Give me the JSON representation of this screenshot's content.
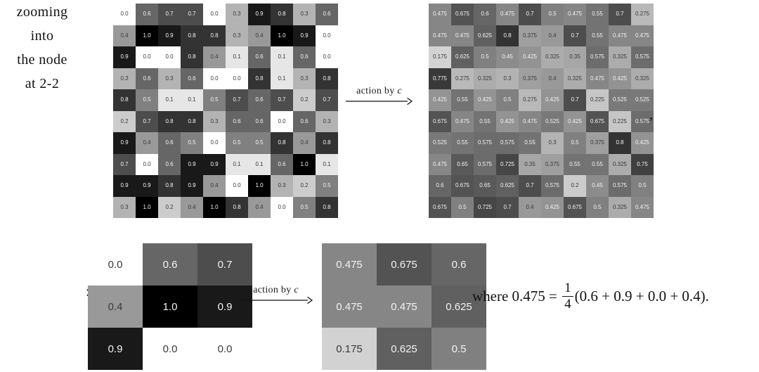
{
  "figure": {
    "arrow_top": {
      "label_plain": "action by ",
      "label_italic": "c"
    },
    "arrow_bottom": {
      "label_plain": "action by ",
      "label_italic": "c"
    },
    "comma": ",",
    "zoom_caption": "zooming\ninto\nthe node\nat 2-2",
    "zoom_caption_lines": [
      "zooming",
      "into",
      "the node",
      "at 2-2"
    ],
    "zoom_caption_colon": ":",
    "formula": {
      "prefix": "where 0.475 = ",
      "numerator": "1",
      "denominator": "4",
      "body": "(0.6 + 0.9 + 0.0 + 0.4)."
    }
  },
  "chart_data": {
    "type": "heatmap",
    "title": "",
    "grids": [
      {
        "name": "grid-before",
        "label": "input 10x10 grayscale grid",
        "rows": 10,
        "cols": 10,
        "vmin": 0.0,
        "vmax": 1.0,
        "colormap": "gray_inverted",
        "values": [
          [
            0.0,
            0.6,
            0.7,
            0.7,
            0.0,
            0.3,
            0.9,
            0.8,
            0.3,
            0.6
          ],
          [
            0.4,
            1.0,
            0.9,
            0.8,
            0.8,
            0.3,
            0.4,
            1.0,
            0.9,
            0.0
          ],
          [
            0.9,
            0.0,
            0.0,
            0.8,
            0.4,
            0.1,
            0.6,
            0.1,
            0.6,
            0.0
          ],
          [
            0.3,
            0.6,
            0.3,
            0.6,
            0.0,
            0.0,
            0.8,
            0.1,
            0.3,
            0.8
          ],
          [
            0.8,
            0.5,
            0.1,
            0.1,
            0.5,
            0.7,
            0.6,
            0.7,
            0.2,
            0.7
          ],
          [
            0.2,
            0.7,
            0.8,
            0.8,
            0.3,
            0.6,
            0.6,
            0.0,
            0.6,
            0.3
          ],
          [
            0.9,
            0.4,
            0.6,
            0.5,
            0.0,
            0.5,
            0.5,
            0.8,
            0.4,
            0.8
          ],
          [
            0.7,
            0.0,
            0.6,
            0.9,
            0.9,
            0.1,
            0.1,
            0.6,
            1.0,
            0.1
          ],
          [
            0.9,
            0.9,
            0.8,
            0.9,
            0.4,
            0.0,
            1.0,
            0.3,
            0.2,
            0.5
          ],
          [
            0.3,
            1.0,
            0.2,
            0.4,
            1.0,
            0.8,
            0.4,
            0.0,
            0.5,
            0.8
          ]
        ],
        "labels": [
          [
            "0.0",
            "0.6",
            "0.7",
            "0.7",
            "0.0",
            "0.3",
            "0.9",
            "0.8",
            "0.3",
            "0.6"
          ],
          [
            "0.4",
            "1.0",
            "0.9",
            "0.8",
            "0.8",
            "0.3",
            "0.4",
            "1.0",
            "0.9",
            "0.0"
          ],
          [
            "0.9",
            "0.0",
            "0.0",
            "0.8",
            "0.4",
            "0.1",
            "0.6",
            "0.1",
            "0.6",
            "0.0"
          ],
          [
            "0.3",
            "0.6",
            "0.3",
            "0.6",
            "0.0",
            "0.0",
            "0.8",
            "0.1",
            "0.3",
            "0.8"
          ],
          [
            "0.8",
            "0.5",
            "0.1",
            "0.1",
            "0.5",
            "0.7",
            "0.6",
            "0.7",
            "0.2",
            "0.7"
          ],
          [
            "0.2",
            "0.7",
            "0.8",
            "0.8",
            "0.3",
            "0.6",
            "0.6",
            "0.0",
            "0.6",
            "0.3"
          ],
          [
            "0.9",
            "0.4",
            "0.6",
            "0.5",
            "0.0",
            "0.5",
            "0.5",
            "0.8",
            "0.4",
            "0.8"
          ],
          [
            "0.7",
            "0.0",
            "0.6",
            "0.9",
            "0.9",
            "0.1",
            "0.1",
            "0.6",
            "1.0",
            "0.1"
          ],
          [
            "0.9",
            "0.9",
            "0.8",
            "0.9",
            "0.4",
            "0.0",
            "1.0",
            "0.3",
            "0.2",
            "0.5"
          ],
          [
            "0.3",
            "1.0",
            "0.2",
            "0.4",
            "1.0",
            "0.8",
            "0.4",
            "0.0",
            "0.5",
            "0.8"
          ]
        ]
      },
      {
        "name": "grid-after",
        "label": "output 10x10 grayscale grid after action by c",
        "rows": 10,
        "cols": 10,
        "vmin": 0.0,
        "vmax": 1.0,
        "colormap": "gray_inverted",
        "values": [
          [
            0.475,
            0.675,
            0.6,
            0.475,
            0.7,
            0.5,
            0.475,
            0.55,
            0.7,
            0.275
          ],
          [
            0.475,
            0.475,
            0.625,
            0.8,
            0.375,
            0.4,
            0.7,
            0.55,
            0.475,
            0.475
          ],
          [
            0.175,
            0.625,
            0.5,
            0.45,
            0.425,
            0.325,
            0.35,
            0.575,
            0.325,
            0.575
          ],
          [
            0.775,
            0.275,
            0.325,
            0.3,
            0.375,
            0.4,
            0.325,
            0.475,
            0.425,
            0.325
          ],
          [
            0.425,
            0.55,
            0.425,
            0.5,
            0.275,
            0.425,
            0.7,
            0.225,
            0.525,
            0.525
          ],
          [
            0.675,
            0.475,
            0.55,
            0.425,
            0.475,
            0.525,
            0.425,
            0.675,
            0.225,
            0.575
          ],
          [
            0.525,
            0.55,
            0.575,
            0.575,
            0.55,
            0.3,
            0.5,
            0.375,
            0.8,
            0.425
          ],
          [
            0.475,
            0.65,
            0.575,
            0.725,
            0.35,
            0.375,
            0.55,
            0.55,
            0.325,
            0.75
          ],
          [
            0.6,
            0.675,
            0.65,
            0.625,
            0.7,
            0.575,
            0.2,
            0.45,
            0.575,
            0.5
          ],
          [
            0.675,
            0.5,
            0.725,
            0.7,
            0.4,
            0.425,
            0.675,
            0.5,
            0.325,
            0.475
          ]
        ],
        "labels": [
          [
            "0.475",
            "0.675",
            "0.6",
            "0.475",
            "0.7",
            "0.5",
            "0.475",
            "0.55",
            "0.7",
            "0.275"
          ],
          [
            "0.475",
            "0.475",
            "0.625",
            "0.8",
            "0.375",
            "0.4",
            "0.7",
            "0.55",
            "0.475",
            "0.475"
          ],
          [
            "0.175",
            "0.625",
            "0.5",
            "0.45",
            "0.425",
            "0.325",
            "0.35",
            "0.575",
            "0.325",
            "0.575"
          ],
          [
            "0.775",
            "0.275",
            "0.325",
            "0.3",
            "0.375",
            "0.4",
            "0.325",
            "0.475",
            "0.425",
            "0.325"
          ],
          [
            "0.425",
            "0.55",
            "0.425",
            "0.5",
            "0.275",
            "0.425",
            "0.7",
            "0.225",
            "0.525",
            "0.525"
          ],
          [
            "0.675",
            "0.475",
            "0.55",
            "0.425",
            "0.475",
            "0.525",
            "0.425",
            "0.675",
            "0.225",
            "0.575"
          ],
          [
            "0.525",
            "0.55",
            "0.575",
            "0.575",
            "0.55",
            "0.3",
            "0.5",
            "0.375",
            "0.8",
            "0.425"
          ],
          [
            "0.475",
            "0.65",
            "0.575",
            "0.725",
            "0.35",
            "0.375",
            "0.55",
            "0.55",
            "0.325",
            "0.75"
          ],
          [
            "0.6",
            "0.675",
            "0.65",
            "0.625",
            "0.7",
            "0.575",
            "0.2",
            "0.45",
            "0.575",
            "0.5"
          ],
          [
            "0.675",
            "0.5",
            "0.725",
            "0.7",
            "0.4",
            "0.425",
            "0.675",
            "0.5",
            "0.325",
            "0.475"
          ]
        ]
      },
      {
        "name": "grid-zoom-before",
        "label": "zoomed 3x3 neighbourhood at node 2-2 before action",
        "rows": 3,
        "cols": 3,
        "vmin": 0.0,
        "vmax": 1.0,
        "colormap": "gray_inverted",
        "values": [
          [
            0.0,
            0.6,
            0.7
          ],
          [
            0.4,
            1.0,
            0.9
          ],
          [
            0.9,
            0.0,
            0.0
          ]
        ],
        "labels": [
          [
            "0.0",
            "0.6",
            "0.7"
          ],
          [
            "0.4",
            "1.0",
            "0.9"
          ],
          [
            "0.9",
            "0.0",
            "0.0"
          ]
        ]
      },
      {
        "name": "grid-zoom-after",
        "label": "zoomed 3x3 neighbourhood at node 2-2 after action",
        "rows": 3,
        "cols": 3,
        "vmin": 0.0,
        "vmax": 1.0,
        "colormap": "gray_inverted",
        "values": [
          [
            0.475,
            0.675,
            0.6
          ],
          [
            0.475,
            0.475,
            0.625
          ],
          [
            0.175,
            0.625,
            0.5
          ]
        ],
        "labels": [
          [
            "0.475",
            "0.675",
            "0.6"
          ],
          [
            "0.475",
            "0.475",
            "0.625"
          ],
          [
            "0.175",
            "0.625",
            "0.5"
          ]
        ]
      }
    ]
  }
}
